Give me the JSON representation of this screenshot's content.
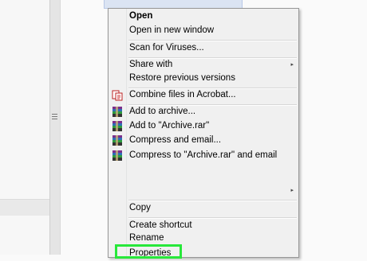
{
  "menu": {
    "items": [
      {
        "label": "Open",
        "bold": true
      },
      {
        "label": "Open in new window"
      },
      {
        "label": "Scan for Viruses..."
      },
      {
        "label": "Share with",
        "submenu": true
      },
      {
        "label": "Restore previous versions"
      },
      {
        "label": "Combine files in Acrobat...",
        "icon": "acrobat-combine-icon"
      },
      {
        "label": "Add to archive...",
        "icon": "winrar-icon"
      },
      {
        "label": "Add to \"Archive.rar\"",
        "icon": "winrar-icon"
      },
      {
        "label": "Compress and email...",
        "icon": "winrar-icon"
      },
      {
        "label": "Compress to \"Archive.rar\" and email",
        "icon": "winrar-icon"
      },
      {
        "label": "",
        "submenu": true
      },
      {
        "label": "Copy"
      },
      {
        "label": "Create shortcut"
      },
      {
        "label": "Rename"
      },
      {
        "label": "Properties"
      }
    ],
    "submenu_arrow": "▸"
  },
  "highlight_color": "#27e83a"
}
